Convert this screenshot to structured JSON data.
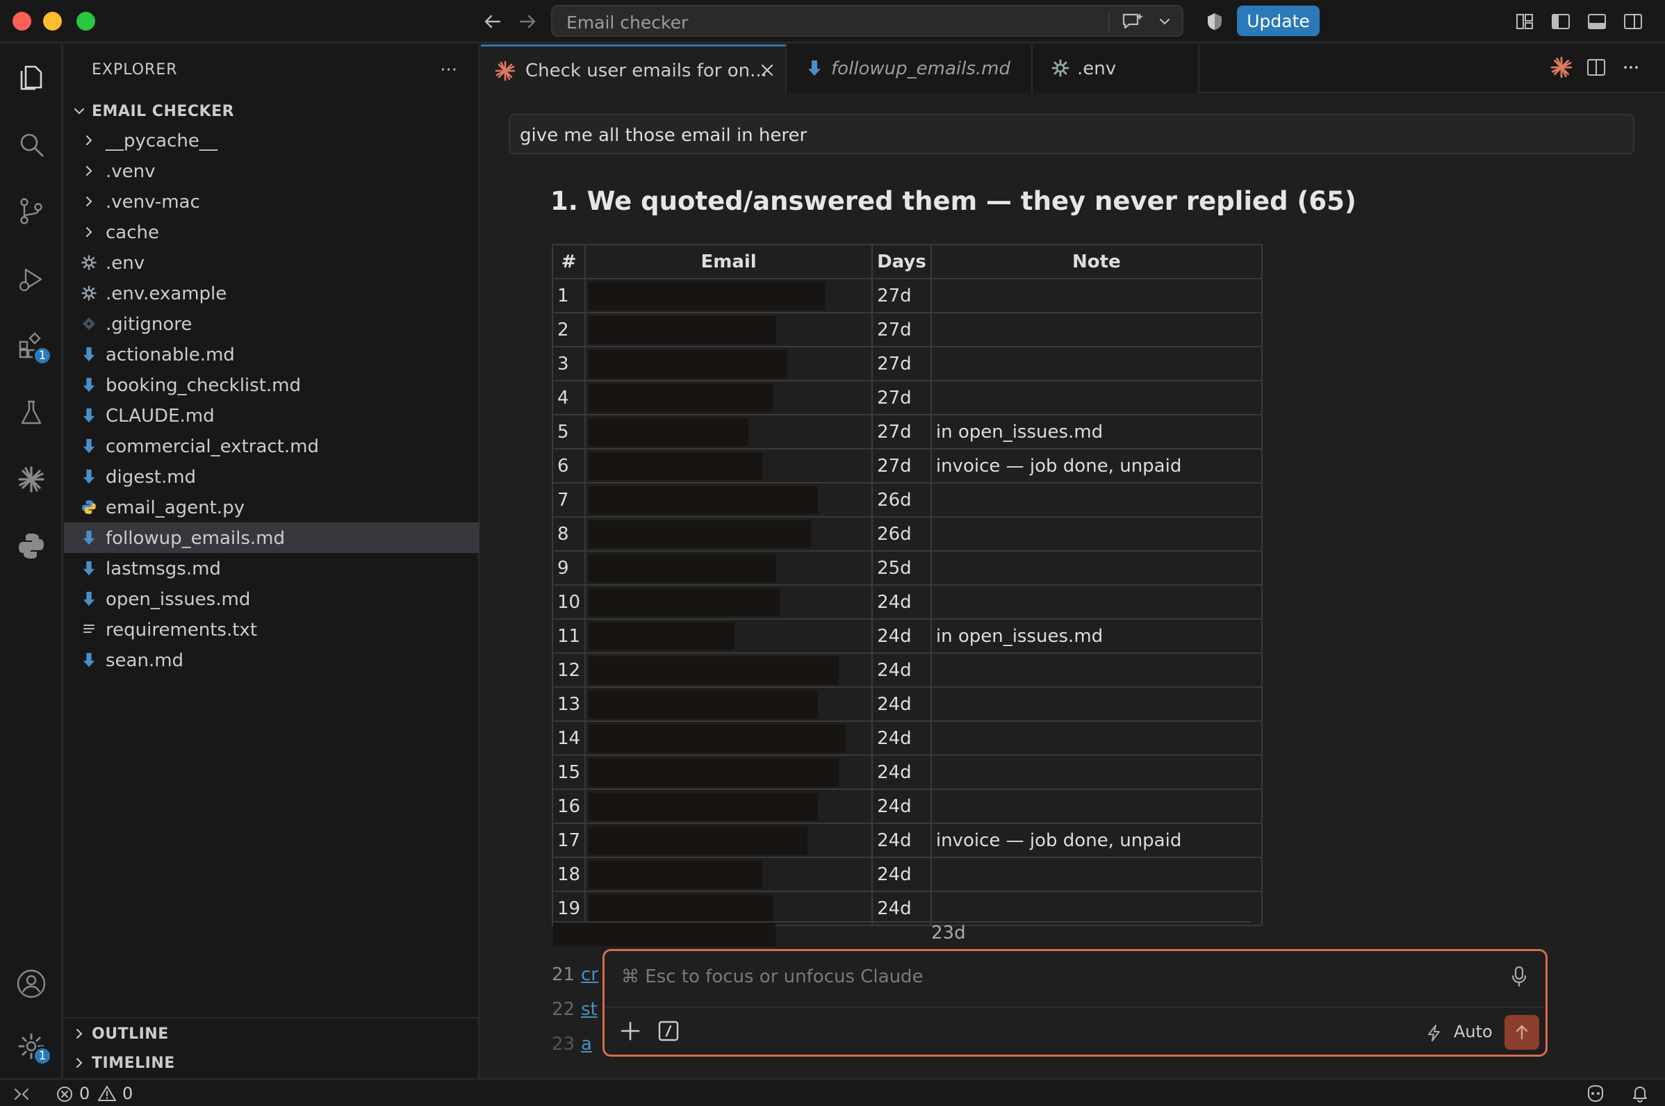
{
  "titlebar": {
    "command_center": "Email checker",
    "update_label": "Update"
  },
  "activity_badges": {
    "extensions": "1",
    "settings": "1"
  },
  "sidebar": {
    "header": "EXPLORER",
    "more": "···",
    "folder": "EMAIL CHECKER",
    "items": [
      {
        "label": "__pycache__",
        "icon": "chevron-right-icon"
      },
      {
        "label": ".venv",
        "icon": "chevron-right-icon"
      },
      {
        "label": ".venv-mac",
        "icon": "chevron-right-icon"
      },
      {
        "label": "cache",
        "icon": "chevron-right-icon"
      },
      {
        "label": ".env",
        "icon": "gear-icon"
      },
      {
        "label": ".env.example",
        "icon": "gear-icon"
      },
      {
        "label": ".gitignore",
        "icon": "git-icon"
      },
      {
        "label": "actionable.md",
        "icon": "markdown-icon"
      },
      {
        "label": "booking_checklist.md",
        "icon": "markdown-icon"
      },
      {
        "label": "CLAUDE.md",
        "icon": "markdown-icon"
      },
      {
        "label": "commercial_extract.md",
        "icon": "markdown-icon"
      },
      {
        "label": "digest.md",
        "icon": "markdown-icon"
      },
      {
        "label": "email_agent.py",
        "icon": "python-icon"
      },
      {
        "label": "followup_emails.md",
        "icon": "markdown-icon",
        "selected": true
      },
      {
        "label": "lastmsgs.md",
        "icon": "markdown-icon"
      },
      {
        "label": "open_issues.md",
        "icon": "markdown-icon"
      },
      {
        "label": "requirements.txt",
        "icon": "text-file-icon"
      },
      {
        "label": "sean.md",
        "icon": "markdown-icon"
      }
    ],
    "outline": "OUTLINE",
    "timeline": "TIMELINE"
  },
  "tabs": [
    {
      "label": "Check user emails for on...",
      "icon": "claude-icon",
      "active": true
    },
    {
      "label": "followup_emails.md",
      "icon": "markdown-icon",
      "italic": true
    },
    {
      "label": ".env",
      "icon": "gear-icon"
    }
  ],
  "editor": {
    "prompt": "give me all those email in herer",
    "heading": "1. We quoted/answered them — they never replied (65)",
    "table": {
      "headers": [
        "#",
        "Email",
        "Days",
        "Note"
      ],
      "rows": [
        {
          "n": "1",
          "days": "27d",
          "note": "",
          "rw": 340
        },
        {
          "n": "2",
          "days": "27d",
          "note": "",
          "rw": 270
        },
        {
          "n": "3",
          "days": "27d",
          "note": "",
          "rw": 285
        },
        {
          "n": "4",
          "days": "27d",
          "note": "",
          "rw": 265
        },
        {
          "n": "5",
          "days": "27d",
          "note": "in open_issues.md",
          "rw": 230
        },
        {
          "n": "6",
          "days": "27d",
          "note": "invoice — job done, unpaid",
          "rw": 250
        },
        {
          "n": "7",
          "days": "26d",
          "note": "",
          "rw": 330
        },
        {
          "n": "8",
          "days": "26d",
          "note": "",
          "rw": 320
        },
        {
          "n": "9",
          "days": "25d",
          "note": "",
          "rw": 270
        },
        {
          "n": "10",
          "days": "24d",
          "note": "",
          "rw": 275
        },
        {
          "n": "11",
          "days": "24d",
          "note": "in open_issues.md",
          "rw": 210
        },
        {
          "n": "12",
          "days": "24d",
          "note": "",
          "rw": 360
        },
        {
          "n": "13",
          "days": "24d",
          "note": "",
          "rw": 330
        },
        {
          "n": "14",
          "days": "24d",
          "note": "",
          "rw": 370
        },
        {
          "n": "15",
          "days": "24d",
          "note": "",
          "rw": 360
        },
        {
          "n": "16",
          "days": "24d",
          "note": "",
          "rw": 330
        },
        {
          "n": "17",
          "days": "24d",
          "note": "invoice — job done, unpaid",
          "rw": 315
        },
        {
          "n": "18",
          "days": "24d",
          "note": "",
          "rw": 250
        },
        {
          "n": "19",
          "days": "24d",
          "note": "",
          "rw": 265
        }
      ],
      "partial": [
        {
          "n": "",
          "days": "23d"
        },
        {
          "n": "21",
          "link": "cr"
        },
        {
          "n": "22",
          "link": "st"
        },
        {
          "n": "23",
          "link": "a"
        }
      ]
    }
  },
  "chat": {
    "placeholder": "⌘ Esc to focus or unfocus Claude",
    "mode": "Auto"
  },
  "statusbar": {
    "errors": "0",
    "warnings": "0"
  }
}
